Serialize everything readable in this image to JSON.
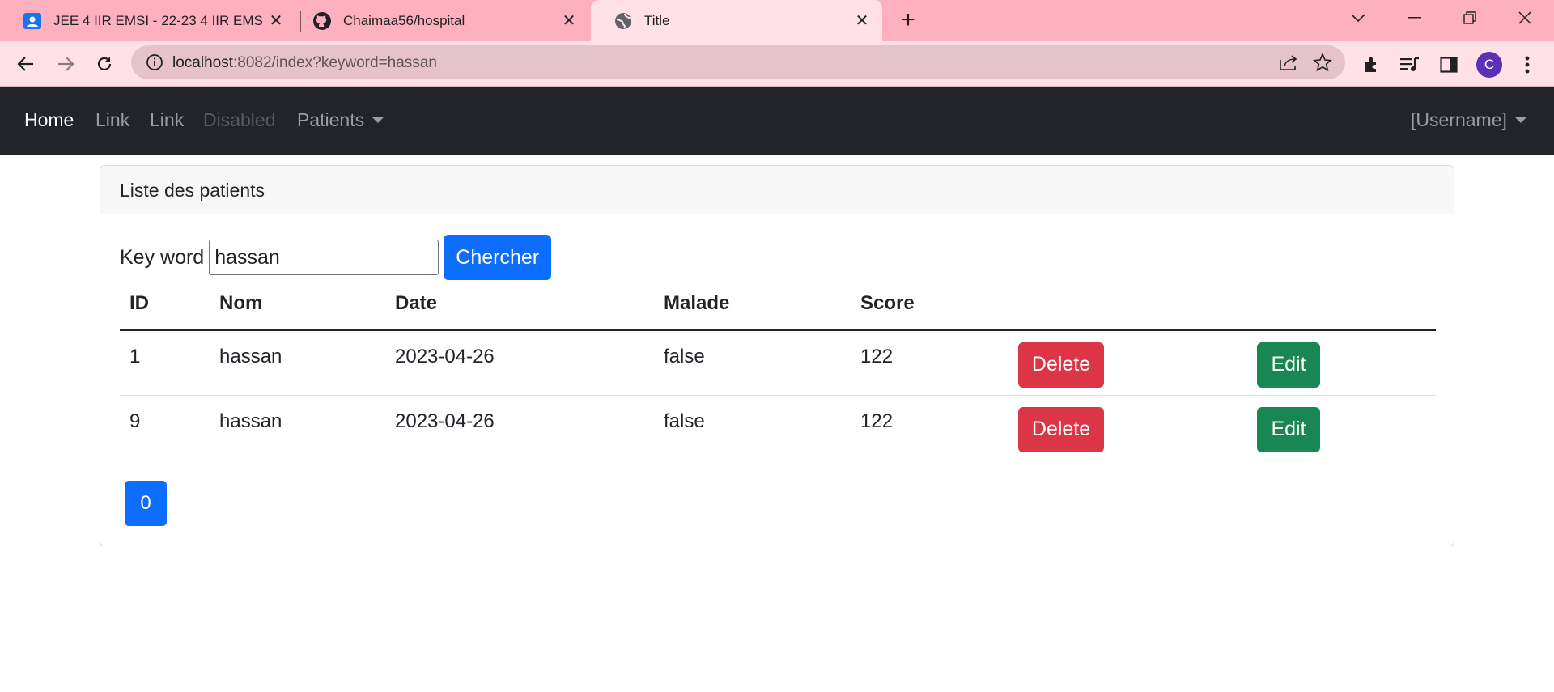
{
  "browser": {
    "tabs": [
      {
        "title": "JEE 4 IIR EMSI - 22-23 4 IIR EMSI",
        "icon": "classroom-icon"
      },
      {
        "title": "Chaimaa56/hospital",
        "icon": "github-icon"
      },
      {
        "title": "Title",
        "icon": "globe-icon",
        "active": true
      }
    ],
    "url_host": "localhost",
    "url_rest": ":8082/index?keyword=hassan",
    "profile_initial": "C"
  },
  "navbar": {
    "home": "Home",
    "link1": "Link",
    "link2": "Link",
    "disabled": "Disabled",
    "patients": "Patients",
    "username": "[Username]"
  },
  "card": {
    "header": "Liste des patients",
    "search": {
      "label": "Key word",
      "value": "hassan",
      "button": "Chercher"
    },
    "table": {
      "columns": [
        "ID",
        "Nom",
        "Date",
        "Malade",
        "Score"
      ],
      "rows": [
        {
          "id": "1",
          "nom": "hassan",
          "date": "2023-04-26",
          "malade": "false",
          "score": "122",
          "delete": "Delete",
          "edit": "Edit"
        },
        {
          "id": "9",
          "nom": "hassan",
          "date": "2023-04-26",
          "malade": "false",
          "score": "122",
          "delete": "Delete",
          "edit": "Edit"
        }
      ]
    },
    "pagination": [
      "0"
    ]
  },
  "colors": {
    "tabstrip": "#ffb0bf",
    "navbar": "#212529",
    "primary": "#0d6efd",
    "danger": "#dc3545",
    "success": "#198754"
  }
}
